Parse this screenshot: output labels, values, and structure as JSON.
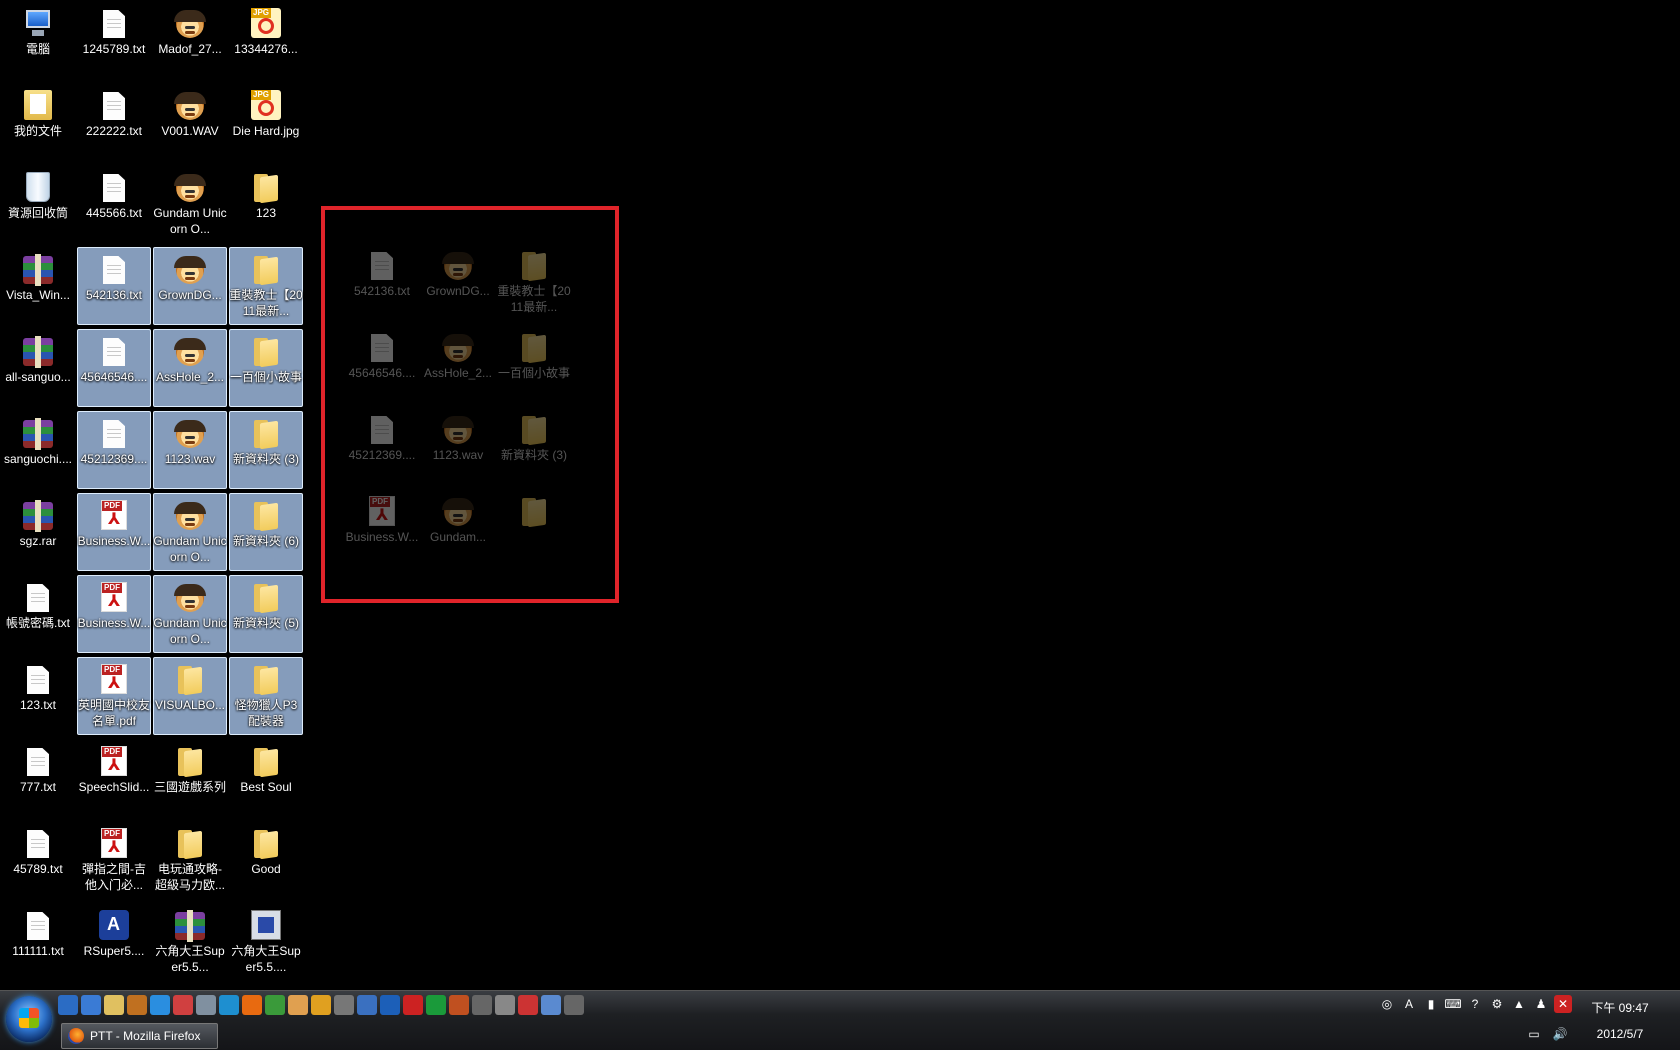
{
  "desktop": {
    "icons": [
      {
        "label": "電腦",
        "type": "computer",
        "selected": false
      },
      {
        "label": "1245789.txt",
        "type": "txt",
        "selected": false
      },
      {
        "label": "Madof_27...",
        "type": "wav",
        "selected": false
      },
      {
        "label": "13344276...",
        "type": "jpg",
        "selected": false
      },
      {
        "label": "我的文件",
        "type": "docs",
        "selected": false
      },
      {
        "label": "222222.txt",
        "type": "txt",
        "selected": false
      },
      {
        "label": "V001.WAV",
        "type": "wav",
        "selected": false
      },
      {
        "label": "Die Hard.jpg",
        "type": "jpg",
        "selected": false
      },
      {
        "label": "資源回收筒",
        "type": "bin",
        "selected": false
      },
      {
        "label": "445566.txt",
        "type": "txt",
        "selected": false
      },
      {
        "label": "Gundam Unicorn O...",
        "type": "wav",
        "selected": false
      },
      {
        "label": "123",
        "type": "folder",
        "selected": false
      },
      {
        "label": "Vista_Win...",
        "type": "rar",
        "selected": false
      },
      {
        "label": "542136.txt",
        "type": "txt",
        "selected": true
      },
      {
        "label": "GrownDG...",
        "type": "wav",
        "selected": true
      },
      {
        "label": "重裝教士【2011最新...",
        "type": "folder",
        "selected": true
      },
      {
        "label": "all-sanguo...",
        "type": "rar",
        "selected": false
      },
      {
        "label": "45646546....",
        "type": "txt",
        "selected": true
      },
      {
        "label": "AssHole_2...",
        "type": "wav",
        "selected": true
      },
      {
        "label": "一百個小故事",
        "type": "folder",
        "selected": true
      },
      {
        "label": "sanguochi....",
        "type": "rar",
        "selected": false
      },
      {
        "label": "45212369....",
        "type": "txt",
        "selected": true
      },
      {
        "label": "1123.wav",
        "type": "wav",
        "selected": true
      },
      {
        "label": "新資料夾 (3)",
        "type": "folder",
        "selected": true
      },
      {
        "label": "sgz.rar",
        "type": "rar",
        "selected": false
      },
      {
        "label": "Business.W...",
        "type": "pdf",
        "selected": true
      },
      {
        "label": "Gundam Unicorn O...",
        "type": "wav",
        "selected": true
      },
      {
        "label": "新資料夾 (6)",
        "type": "folder",
        "selected": true
      },
      {
        "label": "帳號密碼.txt",
        "type": "txt",
        "selected": false
      },
      {
        "label": "Business.W...",
        "type": "pdf",
        "selected": true
      },
      {
        "label": "Gundam Unicorn O...",
        "type": "wav",
        "selected": true
      },
      {
        "label": "新資料夾 (5)",
        "type": "folder",
        "selected": true
      },
      {
        "label": "123.txt",
        "type": "txt",
        "selected": false
      },
      {
        "label": "英明國中校友名單.pdf",
        "type": "pdf",
        "selected": true
      },
      {
        "label": "VISUALBO...",
        "type": "folder",
        "selected": true
      },
      {
        "label": "怪物獵人P3配裝器",
        "type": "folder",
        "selected": true
      },
      {
        "label": "777.txt",
        "type": "txt",
        "selected": false
      },
      {
        "label": "SpeechSlid...",
        "type": "pdf",
        "selected": false
      },
      {
        "label": "三國遊戲系列",
        "type": "folder",
        "selected": false
      },
      {
        "label": "Best Soul",
        "type": "folder",
        "selected": false
      },
      {
        "label": "45789.txt",
        "type": "txt",
        "selected": false
      },
      {
        "label": "彈指之間-吉他入门必...",
        "type": "pdf",
        "selected": false
      },
      {
        "label": "电玩通攻略-超級马力欧...",
        "type": "folder",
        "selected": false
      },
      {
        "label": "Good",
        "type": "folder",
        "selected": false
      },
      {
        "label": "111111.txt",
        "type": "txt",
        "selected": false
      },
      {
        "label": "RSuper5....",
        "type": "exe",
        "selected": false
      },
      {
        "label": "六角大王Super5.5...",
        "type": "rar",
        "selected": false
      },
      {
        "label": "六角大王Super5.5....",
        "type": "setup",
        "selected": false
      }
    ],
    "ghost_icons": [
      {
        "label": "542136.txt",
        "type": "txt"
      },
      {
        "label": "GrownDG...",
        "type": "wav"
      },
      {
        "label": "重裝教士【2011最新...",
        "type": "folder"
      },
      {
        "label": "45646546....",
        "type": "txt"
      },
      {
        "label": "AssHole_2...",
        "type": "wav"
      },
      {
        "label": "一百個小故事",
        "type": "folder"
      },
      {
        "label": "45212369....",
        "type": "txt"
      },
      {
        "label": "1123.wav",
        "type": "wav"
      },
      {
        "label": "新資料夾 (3)",
        "type": "folder"
      },
      {
        "label": "Business.W...",
        "type": "pdf"
      },
      {
        "label": "Gundam...",
        "type": "wav"
      },
      {
        "label": "",
        "type": "folder"
      }
    ],
    "highlight_color": "#e0242a"
  },
  "taskbar": {
    "start_icon": "windows-start-orb-icon",
    "quicklaunch": [
      "show-desktop-icon",
      "notepad-icon",
      "documents-icon",
      "game-icon",
      "thunder-icon",
      "media-icon",
      "disc-icon",
      "ie-icon",
      "firefox-icon",
      "chrome-icon",
      "avatar-icon",
      "player-icon",
      "movie-icon",
      "chat-icon",
      "download-icon",
      "filezilla-icon",
      "h-icon",
      "tool-icon",
      "network-icon",
      "ghost-icon",
      "fire-icon",
      "file-icon",
      "settings-icon"
    ],
    "window_button": {
      "label": "PTT - Mozilla Firefox",
      "icon": "firefox-icon"
    },
    "tray_top": [
      "lang-icon",
      "font-a-icon",
      "panel-icon",
      "keyboard-icon",
      "help-icon",
      "options-icon",
      "expand-icon",
      "user-icon",
      "antivirus-icon"
    ],
    "tray_bottom": [
      "network-icon",
      "volume-icon"
    ],
    "clock_time": "下午 09:47",
    "clock_date": "2012/5/7"
  }
}
